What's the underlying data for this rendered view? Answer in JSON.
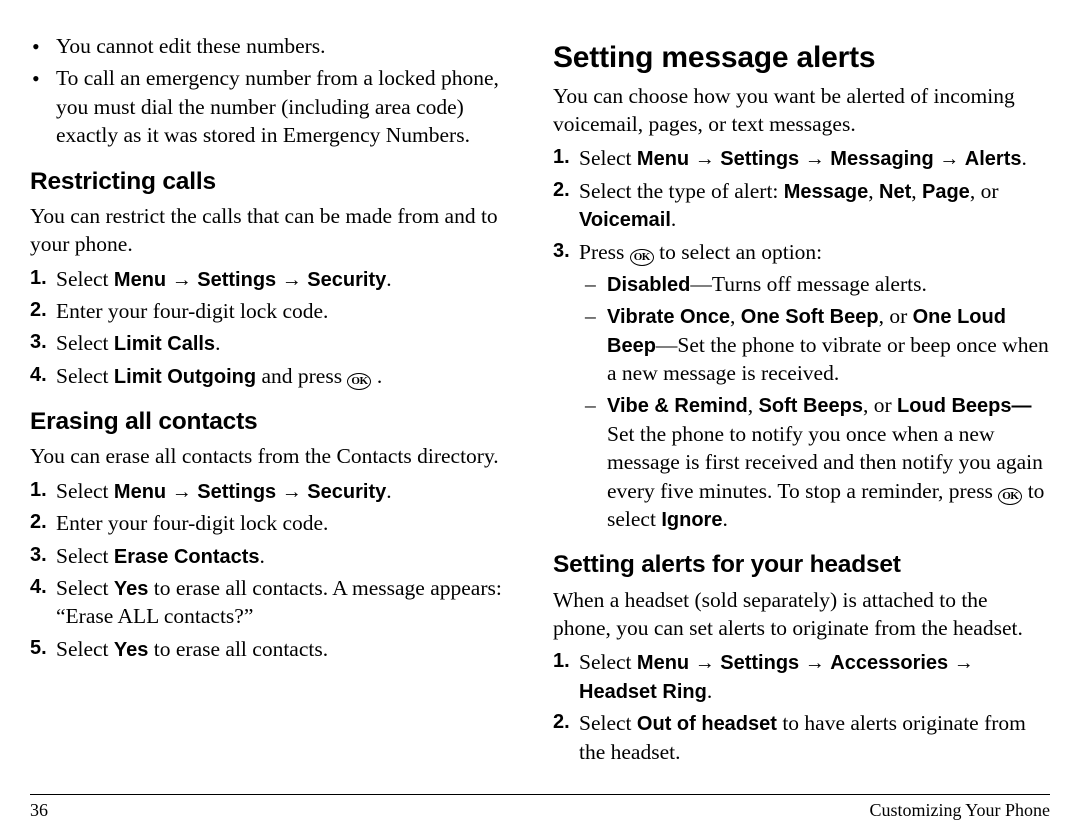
{
  "left": {
    "topBullets": [
      "You cannot edit these numbers.",
      "To call an emergency number from a locked phone, you must dial the number (including area code) exactly as it was stored in Emergency Numbers."
    ],
    "sec1": {
      "heading": "Restricting calls",
      "intro": "You can restrict the calls that can be made from and to your phone.",
      "steps": {
        "s1_select": "Select ",
        "s1_path1": "Menu",
        "s1_path2": "Settings",
        "s1_path3": "Security",
        "s2": "Enter your four-digit lock code.",
        "s3_select": "Select ",
        "s3_limit": "Limit Calls",
        "s4_select": "Select ",
        "s4_limit": "Limit Outgoing",
        "s4_and": " and press ",
        "s4_end": " ."
      }
    },
    "sec2": {
      "heading": "Erasing all contacts",
      "intro": "You can erase all contacts from the Contacts directory.",
      "steps": {
        "s1_select": "Select ",
        "s1_path1": "Menu",
        "s1_path2": "Settings",
        "s1_path3": "Security",
        "s2": "Enter your four-digit lock code.",
        "s3_select": "Select ",
        "s3_bold": "Erase Contacts",
        "s4_select": "Select ",
        "s4_bold": "Yes",
        "s4_rest": " to erase all contacts. A message appears: “Erase ALL contacts?”",
        "s5_select": "Select ",
        "s5_bold": "Yes",
        "s5_rest": " to erase all contacts."
      }
    }
  },
  "right": {
    "mainHeading": "Setting message alerts",
    "intro": "You can choose how you want be alerted of incoming voicemail, pages, or text messages.",
    "steps": {
      "s1_select": "Select ",
      "s1_p1": "Menu",
      "s1_p2": "Settings",
      "s1_p3": "Messaging",
      "s1_p4": "Alerts",
      "s2_a": "Select the type of alert: ",
      "s2_b1": "Message",
      "s2_c1": ", ",
      "s2_b2": "Net",
      "s2_c2": ", ",
      "s2_b3": "Page",
      "s2_c3": ", or ",
      "s2_b4": "Voicemail",
      "s2_end": ".",
      "s3_a": "Press ",
      "s3_b": " to select an option:",
      "d1_b": "Disabled",
      "d1_t": "—Turns off message alerts.",
      "d2_b1": "Vibrate Once",
      "d2_c1": ", ",
      "d2_b2": "One Soft Beep",
      "d2_c2": ", or ",
      "d2_b3": "One Loud Beep",
      "d2_t": "—Set the phone to vibrate or beep once when a new message is received.",
      "d3_b1": "Vibe & Remind",
      "d3_c1": ", ",
      "d3_b2": "Soft Beeps",
      "d3_c2": ", or ",
      "d3_b3": "Loud Beeps",
      "d3_dash": "—",
      "d3_t1": "Set the phone to notify you once when a new message is first received and then notify you again every five minutes. To stop a reminder, press ",
      "d3_t2": " to select ",
      "d3_ig": "Ignore",
      "d3_end": "."
    },
    "sub": {
      "heading": "Setting alerts for your headset",
      "intro": "When a headset (sold separately) is attached to the phone, you can set alerts to originate from the headset.",
      "s1_select": "Select ",
      "s1_p1": "Menu",
      "s1_p2": "Settings",
      "s1_p3": "Accessories",
      "s1_p4": "Headset Ring",
      "s2_select": "Select ",
      "s2_bold": "Out of headset",
      "s2_rest": " to have alerts originate from the headset."
    }
  },
  "icons": {
    "ok": "OK",
    "arrow": " → "
  },
  "footer": {
    "pageNum": "36",
    "section": "Customizing Your Phone"
  }
}
